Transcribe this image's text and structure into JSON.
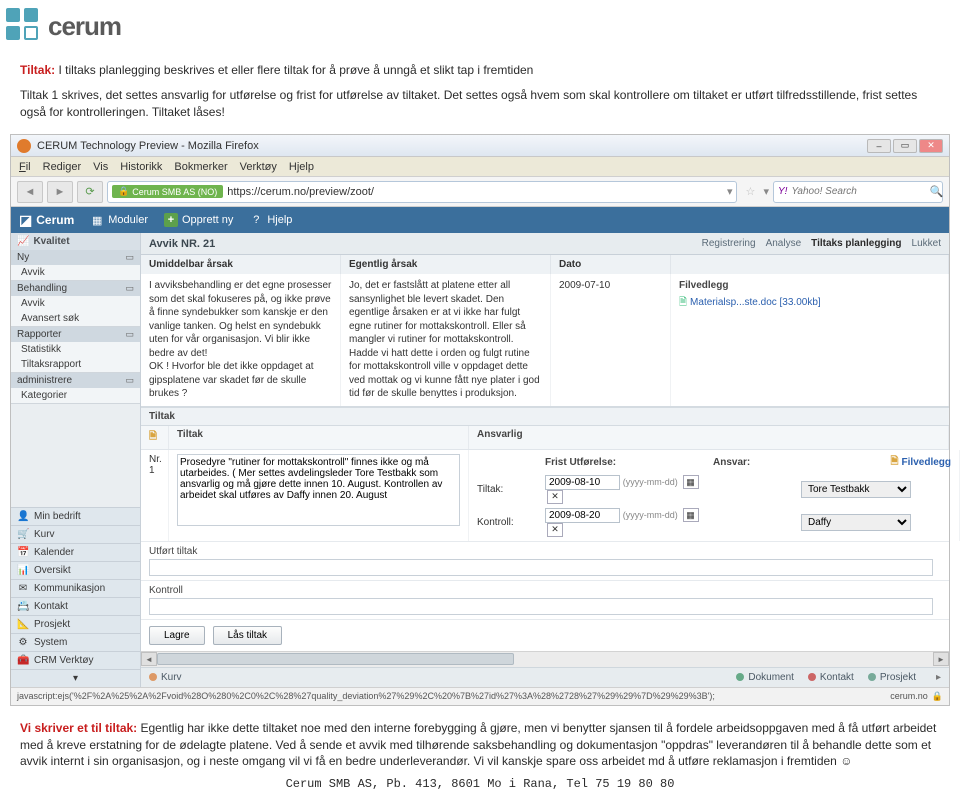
{
  "logo_text": "cerum",
  "intro": {
    "label": "Tiltak:",
    "line1": " I tiltaks planlegging beskrives et eller flere tiltak for å prøve å unngå et slikt tap i fremtiden",
    "para": "Tiltak 1 skrives, det settes ansvarlig for utførelse og frist for utførelse av tiltaket. Det settes også hvem som skal kontrollere om tiltaket er utført tilfredsstillende, frist settes også for kontrolleringen. Tiltaket låses!"
  },
  "window": {
    "title": "CERUM Technology Preview - Mozilla Firefox"
  },
  "menu": {
    "fil": "Fil",
    "rediger": "Rediger",
    "vis": "Vis",
    "historikk": "Historikk",
    "bokmerker": "Bokmerker",
    "verktoy": "Verktøy",
    "hjelp": "Hjelp"
  },
  "url": {
    "badge": "Cerum SMB AS (NO)",
    "text": "https://cerum.no/preview/zoot/"
  },
  "search": {
    "placeholder": "Yahoo! Search"
  },
  "apptop": {
    "brand": "Cerum",
    "moduler": "Moduler",
    "opprett": "Opprett ny",
    "hjelp": "Hjelp"
  },
  "sidebar": {
    "kvalitet": "Kvalitet",
    "ny": "Ny",
    "avvik1": "Avvik",
    "behandling": "Behandling",
    "avvik2": "Avvik",
    "avansert": "Avansert søk",
    "rapporter": "Rapporter",
    "statistikk": "Statistikk",
    "tiltaksrapport": "Tiltaksrapport",
    "administrere": "administrere",
    "kategorier": "Kategorier",
    "bottom": [
      {
        "icon": "👤",
        "label": "Min bedrift"
      },
      {
        "icon": "🛒",
        "label": "Kurv"
      },
      {
        "icon": "📅",
        "label": "Kalender"
      },
      {
        "icon": "📊",
        "label": "Oversikt"
      },
      {
        "icon": "✉",
        "label": "Kommunikasjon"
      },
      {
        "icon": "📇",
        "label": "Kontakt"
      },
      {
        "icon": "📐",
        "label": "Prosjekt"
      },
      {
        "icon": "⚙",
        "label": "System"
      },
      {
        "icon": "🧰",
        "label": "CRM Verktøy"
      }
    ]
  },
  "avvik": {
    "title": "Avvik NR. 21",
    "steps": {
      "reg": "Registrering",
      "analyse": "Analyse",
      "tiltak": "Tiltaks planlegging",
      "lukket": "Lukket"
    },
    "cols": {
      "umiddelbar": "Umiddelbar årsak",
      "egentlig": "Egentlig årsak",
      "dato": "Dato"
    },
    "umiddelbar_text": "I avviksbehandling er det egne prosesser som det skal fokuseres på, og ikke prøve å finne syndebukker som kanskje er den vanlige tanken. Og helst en syndebukk uten for vår organisasjon. Vi blir ikke bedre av det!\nOK ! Hvorfor ble det ikke oppdaget at gipsplatene var skadet før de skulle brukes ?",
    "egentlig_text": "Jo, det er fastslått at platene etter all sansynlighet ble levert skadet. Den egentlige årsaken er at vi ikke har fulgt egne rutiner for mottakskontroll. Eller så mangler vi rutiner for mottakskontroll. Hadde vi hatt dette i orden og fulgt rutine for mottakskontroll ville v oppdaget dette ved mottak og vi kunne fått nye plater i god tid før de skulle benyttes i produksjon.",
    "dato": "2009-07-10",
    "filvedlegg": "Filvedlegg",
    "fil_link": "Materialsp...ste.doc [33.00kb]"
  },
  "tiltak": {
    "head": "Tiltak",
    "col_doc": "",
    "col_tiltak": "Tiltak",
    "col_ansvarlig": "Ansvarlig",
    "nr_label": "Nr. 1",
    "desc": "Prosedyre \"rutiner for mottakskontroll\" finnes ikke og må utarbeides. ( Mer settes avdelingsleder Tore Testbakk som ansvarlig og må gjøre dette innen 10. August. Kontrollen av arbeidet skal utføres av Daffy innen 20. August",
    "frist_utf": "Frist Utførelse:",
    "ansvar": "Ansvar:",
    "tiltak_lab": "Tiltak:",
    "kontroll_lab": "Kontroll:",
    "date1": "2009-08-10",
    "date2": "2009-08-20",
    "hint": "(yyyy-mm-dd)",
    "ansvar1": "Tore Testbakk",
    "ansvar2": "Daffy",
    "filvedlegg": "Filvedlegg",
    "utfort": "Utført tiltak",
    "kontroll": "Kontroll",
    "lagre": "Lagre",
    "laas": "Lås tiltak"
  },
  "bottomtabs": {
    "kurv": "Kurv",
    "dokument": "Dokument",
    "kontakt": "Kontakt",
    "prosjekt": "Prosjekt"
  },
  "status": {
    "js": "javascript:ejs('%2F%2A%25%2A%2Fvoid%28O%280%2C0%2C%28%27quality_deviation%27%29%2C%20%7B%27id%27%3A%28%2728%27%29%29%7D%29%29%3B');",
    "domain": "cerum.no"
  },
  "outro": {
    "label": "Vi skriver et til tiltak:",
    "text": " Egentlig har ikke dette tiltaket noe med den interne forebygging å gjøre, men vi benytter sjansen til å fordele arbeidsoppgaven med å få utført arbeidet med å kreve erstatning for de ødelagte platene. Ved å sende et avvik med tilhørende saksbehandling og dokumentasjon \"oppdras\" leverandøren til å behandle dette som et avvik internt i sin organisasjon, og i neste omgang vil vi få en bedre underleverandør. Vi vil kanskje spare oss arbeidet md å utføre reklamasjon i fremtiden ☺",
    "footer": "Cerum SMB AS, Pb. 413, 8601 Mo i Rana, Tel  75 19 80 80"
  }
}
